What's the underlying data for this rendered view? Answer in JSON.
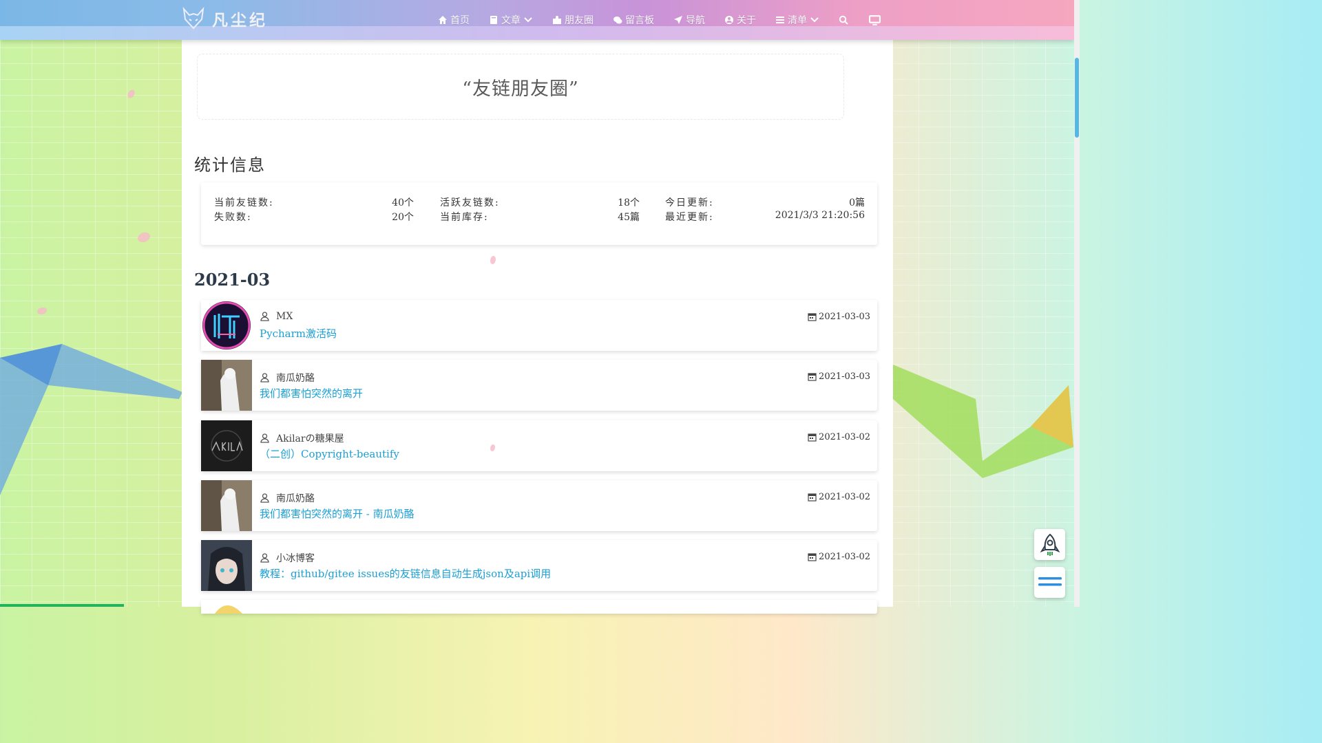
{
  "brand": {
    "name": "凡尘纪"
  },
  "nav": {
    "items": [
      {
        "label": "首页",
        "icon": "home-icon"
      },
      {
        "label": "文章",
        "icon": "book-icon",
        "dropdown": true
      },
      {
        "label": "朋友圈",
        "icon": "puzzle-icon"
      },
      {
        "label": "留言板",
        "icon": "chat-icon"
      },
      {
        "label": "导航",
        "icon": "paper-plane-icon"
      },
      {
        "label": "关于",
        "icon": "user-circle-icon"
      },
      {
        "label": "清单",
        "icon": "list-icon",
        "dropdown": true
      }
    ],
    "search_icon": "search-icon",
    "display_icon": "monitor-icon"
  },
  "page": {
    "quote": "“友链朋友圈”",
    "stats_title": "统计信息",
    "stats": [
      {
        "label": "当前友链数:",
        "value": "40个"
      },
      {
        "label": "失败数:",
        "value": "20个"
      },
      {
        "label": "活跃友链数:",
        "value": "18个"
      },
      {
        "label": "当前库存:",
        "value": "45篇"
      },
      {
        "label": "今日更新:",
        "value": "0篇"
      },
      {
        "label": "最近更新:",
        "value": "2021/3/3 21:20:56"
      }
    ],
    "month": "2021-03",
    "posts": [
      {
        "author": "MX",
        "title": "Pycharm激活码",
        "date": "2021-03-03"
      },
      {
        "author": "南瓜奶酪",
        "title": "我们都害怕突然的离开",
        "date": "2021-03-03"
      },
      {
        "author": "Akilarの糖果屋",
        "title": "（二创）Copyright-beautify",
        "date": "2021-03-02"
      },
      {
        "author": "南瓜奶酪",
        "title": "我们都害怕突然的离开 - 南瓜奶酪",
        "date": "2021-03-02"
      },
      {
        "author": "小冰博客",
        "title": "教程：github/gitee issues的友链信息自动生成json及api调用",
        "date": "2021-03-02"
      }
    ]
  },
  "colors": {
    "link": "#1a9fd6",
    "accent": "#52b8e6",
    "progress": "#22b35c"
  }
}
